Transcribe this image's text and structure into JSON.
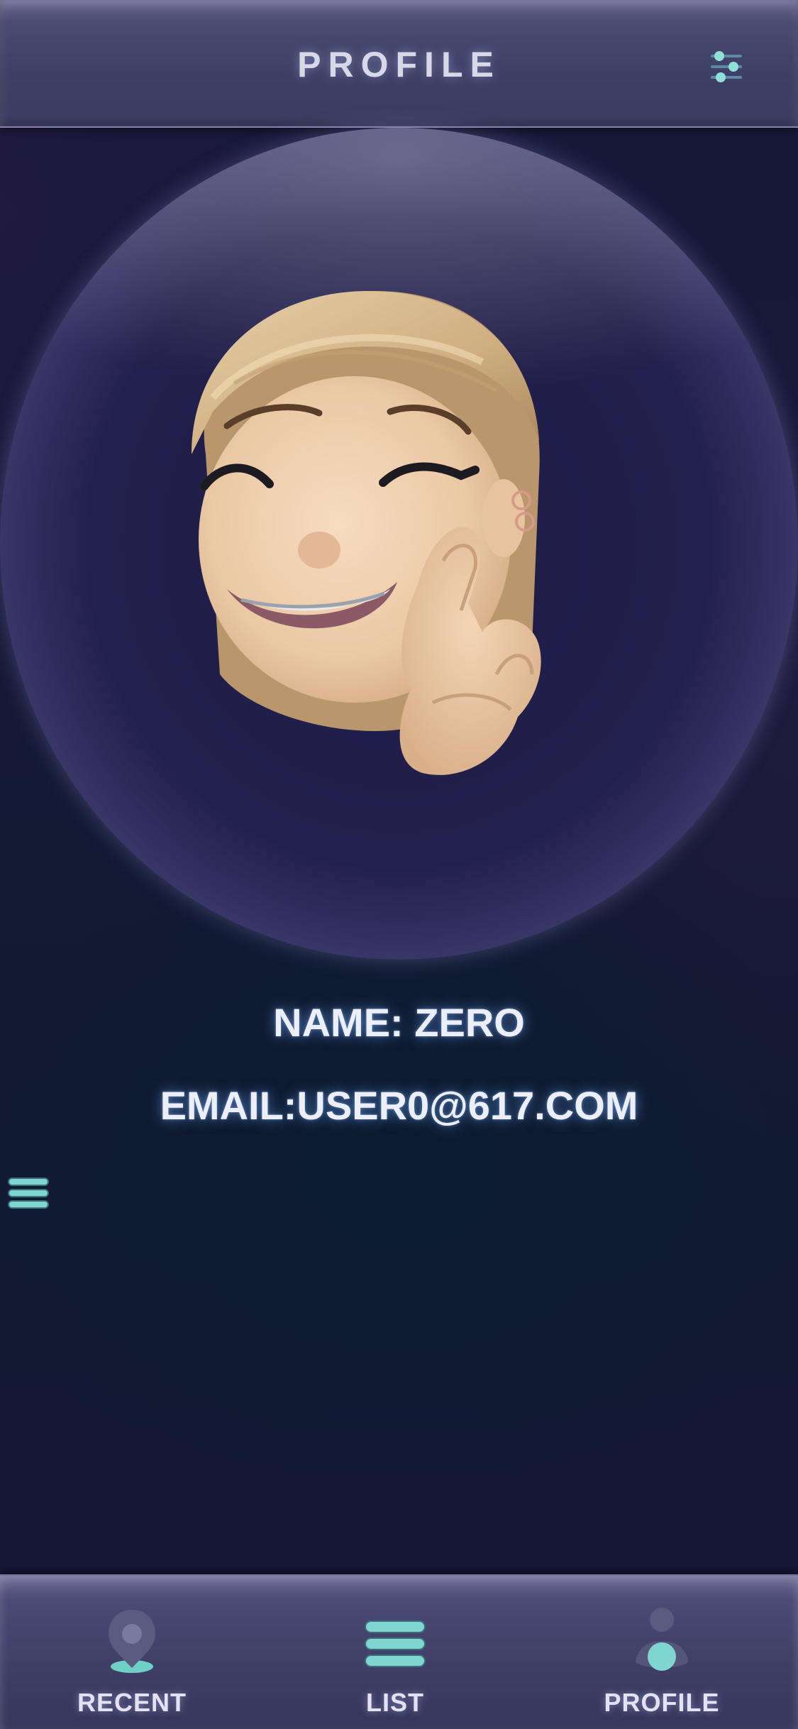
{
  "header": {
    "title": "PROFILE",
    "settings_icon": "sliders-icon"
  },
  "profile": {
    "avatar": "memoji-avatar",
    "name_line": "NAME: ZERO",
    "email_line": "EMAIL:USER0@617.COM"
  },
  "side_menu": {
    "icon": "menu-lines-icon"
  },
  "tabbar": {
    "tabs": [
      {
        "label": "RECENT",
        "icon": "location-pin-icon"
      },
      {
        "label": "LIST",
        "icon": "list-icon"
      },
      {
        "label": "PROFILE",
        "icon": "person-icon",
        "active": true
      }
    ]
  },
  "colors": {
    "background": "#13172f",
    "bar": "#3e3f66",
    "accent_teal": "#7fd6d0",
    "text": "#eceef8",
    "glow": "#6eaaff"
  }
}
